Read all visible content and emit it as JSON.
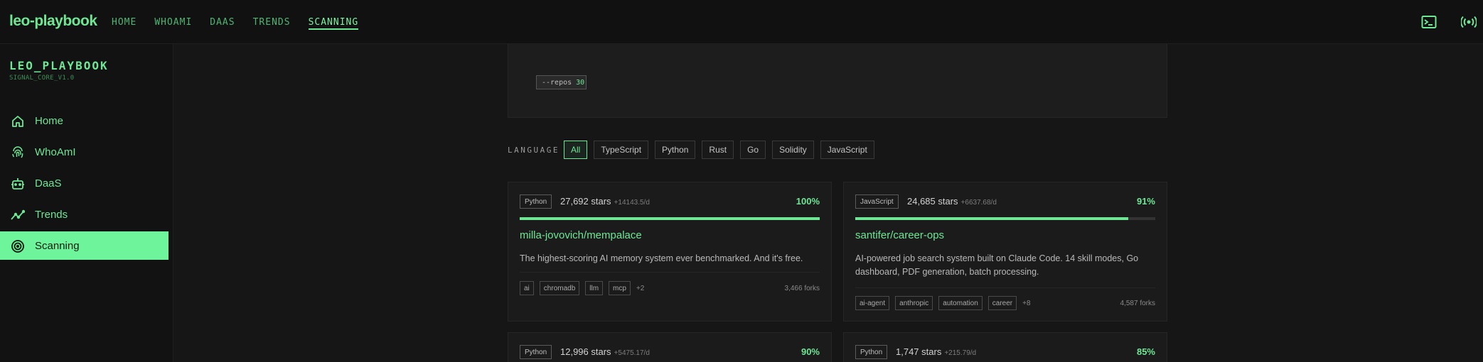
{
  "header": {
    "brand": "leo-playbook",
    "nav": [
      "HOME",
      "WHOAMI",
      "DAAS",
      "TRENDS",
      "SCANNING"
    ],
    "active_nav": "SCANNING",
    "icons": [
      "terminal-icon",
      "broadcast-icon"
    ]
  },
  "sidebar": {
    "title": "LEO_PLAYBOOK",
    "subtitle": "SIGNAL_CORE_V1.0",
    "items": [
      {
        "label": "Home",
        "icon": "home-icon"
      },
      {
        "label": "WhoAmI",
        "icon": "fingerprint-icon"
      },
      {
        "label": "DaaS",
        "icon": "robot-icon"
      },
      {
        "label": "Trends",
        "icon": "trend-icon"
      },
      {
        "label": "Scanning",
        "icon": "scan-icon",
        "active": true
      }
    ]
  },
  "main": {
    "repos_chip": {
      "label": "--repos",
      "value": "30"
    },
    "language_label": "LANGUAGE",
    "filters": [
      "All",
      "TypeScript",
      "Python",
      "Rust",
      "Go",
      "Solidity",
      "JavaScript"
    ],
    "active_filter": "All",
    "cards": [
      {
        "language": "Python",
        "stars": "27,692 stars",
        "per_day": "+14143.5/d",
        "pct": "100%",
        "fill": 1.0,
        "name": "milla-jovovich/mempalace",
        "description": "The highest-scoring AI memory system ever benchmarked. And it's free.",
        "tags": [
          "ai",
          "chromadb",
          "llm",
          "mcp"
        ],
        "more": "+2",
        "forks": "3,466 forks"
      },
      {
        "language": "JavaScript",
        "stars": "24,685 stars",
        "per_day": "+6637.68/d",
        "pct": "91%",
        "fill": 0.91,
        "name": "santifer/career-ops",
        "description": "AI-powered job search system built on Claude Code. 14 skill modes, Go dashboard, PDF generation, batch processing.",
        "tags": [
          "ai-agent",
          "anthropic",
          "automation",
          "career"
        ],
        "more": "+8",
        "forks": "4,587 forks"
      },
      {
        "language": "Python",
        "stars": "12,996 stars",
        "per_day": "+5475.17/d",
        "pct": "90%"
      },
      {
        "language": "Python",
        "stars": "1,747 stars",
        "per_day": "+215.79/d",
        "pct": "85%"
      }
    ]
  },
  "colors": {
    "accent": "#6ee795",
    "accent_bright": "#6ef59c",
    "background": "#161616",
    "card": "#1b1b1b"
  }
}
